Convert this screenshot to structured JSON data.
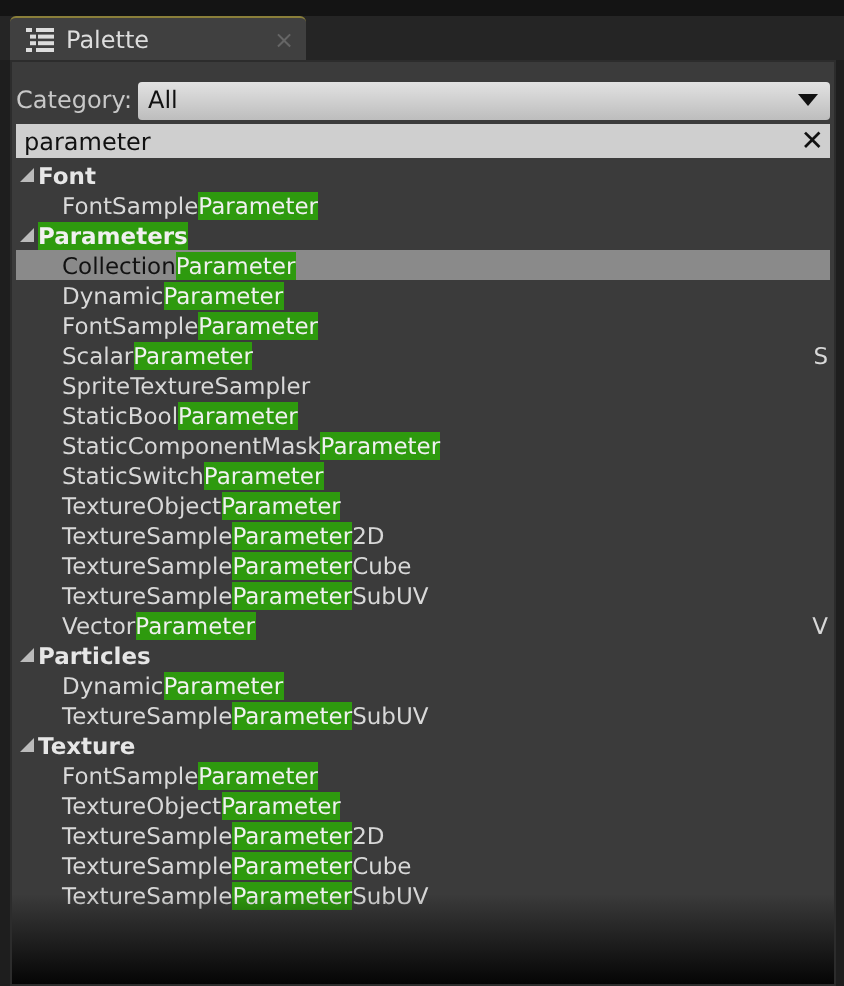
{
  "tab": {
    "title": "Palette",
    "close": "×"
  },
  "category": {
    "label": "Category:",
    "value": "All"
  },
  "search": {
    "value": "parameter",
    "clear": "✕"
  },
  "groups": [
    {
      "expanded": true,
      "pre": "Font",
      "items": [
        {
          "pre": "FontSample",
          "match": "Parameter",
          "selected": false
        }
      ]
    },
    {
      "expanded": true,
      "match": "Parameters",
      "items": [
        {
          "pre": "Collection",
          "match": "Parameter",
          "selected": true
        },
        {
          "pre": "Dynamic",
          "match": "Parameter",
          "selected": false
        },
        {
          "pre": "FontSample",
          "match": "Parameter",
          "selected": false
        },
        {
          "pre": "Scalar",
          "match": "Parameter",
          "side": "S",
          "selected": false
        },
        {
          "pre": "SpriteTextureSampler",
          "selected": false
        },
        {
          "pre": "StaticBool",
          "match": "Parameter",
          "selected": false
        },
        {
          "pre": "StaticComponentMask",
          "match": "Parameter",
          "selected": false
        },
        {
          "pre": "StaticSwitch",
          "match": "Parameter",
          "selected": false
        },
        {
          "pre": "TextureObject",
          "match": "Parameter",
          "selected": false
        },
        {
          "pre": "TextureSample",
          "match": "Parameter",
          "post": "2D",
          "selected": false
        },
        {
          "pre": "TextureSample",
          "match": "Parameter",
          "post": "Cube",
          "selected": false
        },
        {
          "pre": "TextureSample",
          "match": "Parameter",
          "post": "SubUV",
          "selected": false
        },
        {
          "pre": "Vector",
          "match": "Parameter",
          "side": "V",
          "selected": false
        }
      ]
    },
    {
      "expanded": true,
      "pre": "Particles",
      "items": [
        {
          "pre": "Dynamic",
          "match": "Parameter",
          "selected": false
        },
        {
          "pre": "TextureSample",
          "match": "Parameter",
          "post": "SubUV",
          "selected": false
        }
      ]
    },
    {
      "expanded": true,
      "pre": "Texture",
      "items": [
        {
          "pre": "FontSample",
          "match": "Parameter",
          "selected": false
        },
        {
          "pre": "TextureObject",
          "match": "Parameter",
          "selected": false
        },
        {
          "pre": "TextureSample",
          "match": "Parameter",
          "post": "2D",
          "selected": false
        },
        {
          "pre": "TextureSample",
          "match": "Parameter",
          "post": "Cube",
          "selected": false
        },
        {
          "pre": "TextureSample",
          "match": "Parameter",
          "post": "SubUV",
          "selected": false
        }
      ]
    }
  ]
}
